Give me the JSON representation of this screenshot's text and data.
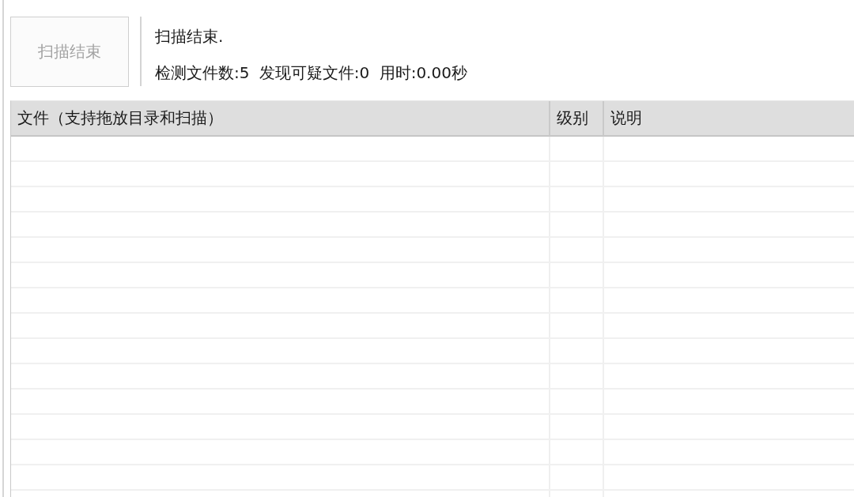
{
  "scan_button": {
    "label": "扫描结束",
    "disabled": true
  },
  "status": {
    "title": "扫描结束.",
    "summary": "检测文件数:5 发现可疑文件:0 用时:0.00秒"
  },
  "table": {
    "columns": [
      "文件（支持拖放目录和扫描）",
      "级别",
      "说明"
    ]
  }
}
